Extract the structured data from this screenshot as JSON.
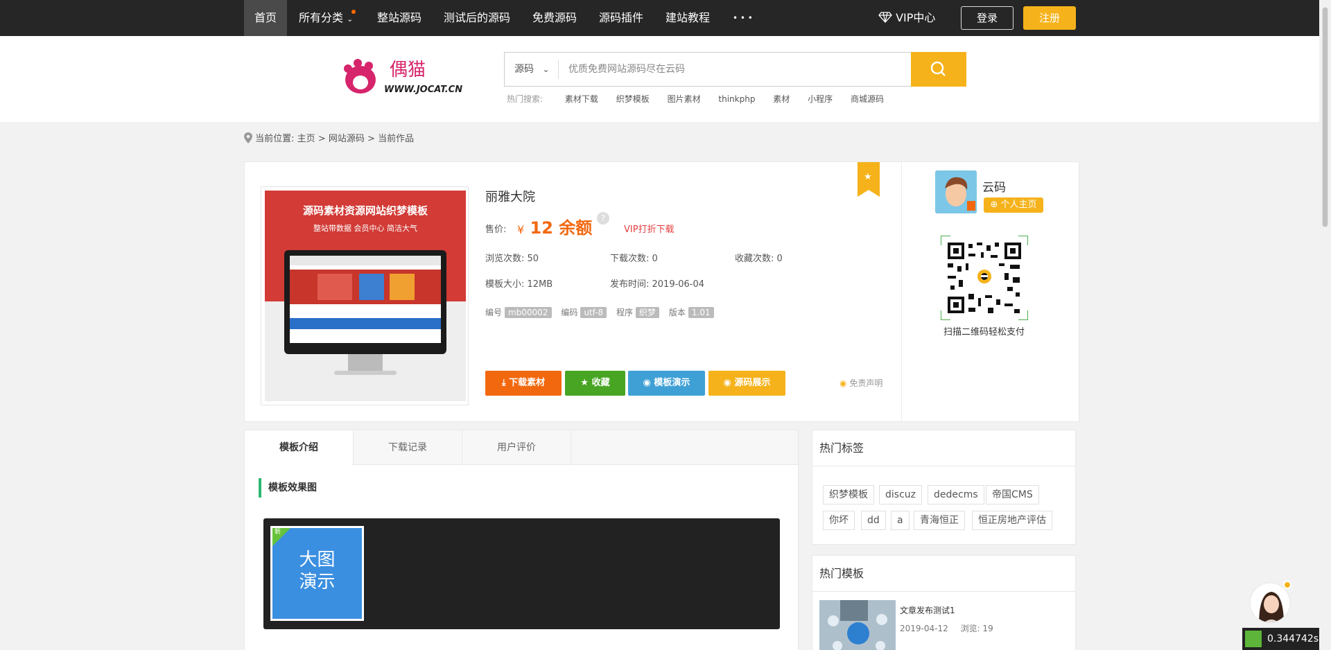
{
  "nav": {
    "items": [
      "首页",
      "所有分类",
      "整站源码",
      "测试后的源码",
      "免费源码",
      "源码插件",
      "建站教程",
      "• • •"
    ],
    "vip": "VIP中心",
    "login": "登录",
    "register": "注册"
  },
  "logo": {
    "brand": "偶猫",
    "site": "WWW.JOCAT.CN"
  },
  "search": {
    "category": "源码",
    "placeholder": "优质免费网站源码尽在云码",
    "hot_label": "热门搜索:",
    "hot": [
      "素材下载",
      "织梦模板",
      "图片素材",
      "thinkphp",
      "素材",
      "小程序",
      "商城源码"
    ]
  },
  "breadcrumb": {
    "label": "当前位置:",
    "items": [
      "主页",
      "网站源码",
      "当前作品"
    ],
    "sep": ">"
  },
  "product": {
    "thumb_headline": "源码素材资源网站织梦模板",
    "thumb_sub": "整站带数据 会员中心 简洁大气",
    "title": "丽雅大院",
    "price_label": "售价:",
    "price_symbol": "¥",
    "price_value": "12 余额",
    "help": "?",
    "vip_discount": "VIP打折下载",
    "views": "浏览次数:  50",
    "downloads": "下载次数:  0",
    "favorites": "收藏次数:  0",
    "size": "模板大小:  12MB",
    "published": "发布时间:  2019-06-04",
    "tags": [
      {
        "k": "编号",
        "v": "mb00002"
      },
      {
        "k": "编码",
        "v": "utf-8"
      },
      {
        "k": "程序",
        "v": "织梦"
      },
      {
        "k": "版本",
        "v": "1.01"
      }
    ],
    "buttons": {
      "download": "下载素材",
      "favorite": "收藏",
      "demo": "模板演示",
      "source": "源码展示"
    },
    "disclaimer": "免责声明",
    "colors": {
      "download": "#f2680f",
      "favorite": "#48a523",
      "demo": "#3fa0d6",
      "source": "#f5b21a"
    }
  },
  "author": {
    "name": "云码",
    "home": "个人主页",
    "qr_caption": "扫描二维码轻松支付"
  },
  "tabs": [
    "模板介绍",
    "下载记录",
    "用户评价"
  ],
  "intro": {
    "section_title": "模板效果图",
    "tile_text_1": "大图",
    "tile_text_2": "演示",
    "new_badge": "新"
  },
  "hot_tags": {
    "title": "热门标签",
    "row1": [
      "织梦模板",
      "discuz",
      "dedecms",
      "帝国CMS"
    ],
    "row2": [
      "你坏",
      "dd",
      "a",
      "青海恒正",
      "恒正房地产评估"
    ]
  },
  "hot_templates": {
    "title": "热门模板",
    "items": [
      {
        "title": "文章发布测试1",
        "date": "2019-04-12",
        "views": "浏览:  19"
      }
    ]
  },
  "timer": "0.344742s"
}
